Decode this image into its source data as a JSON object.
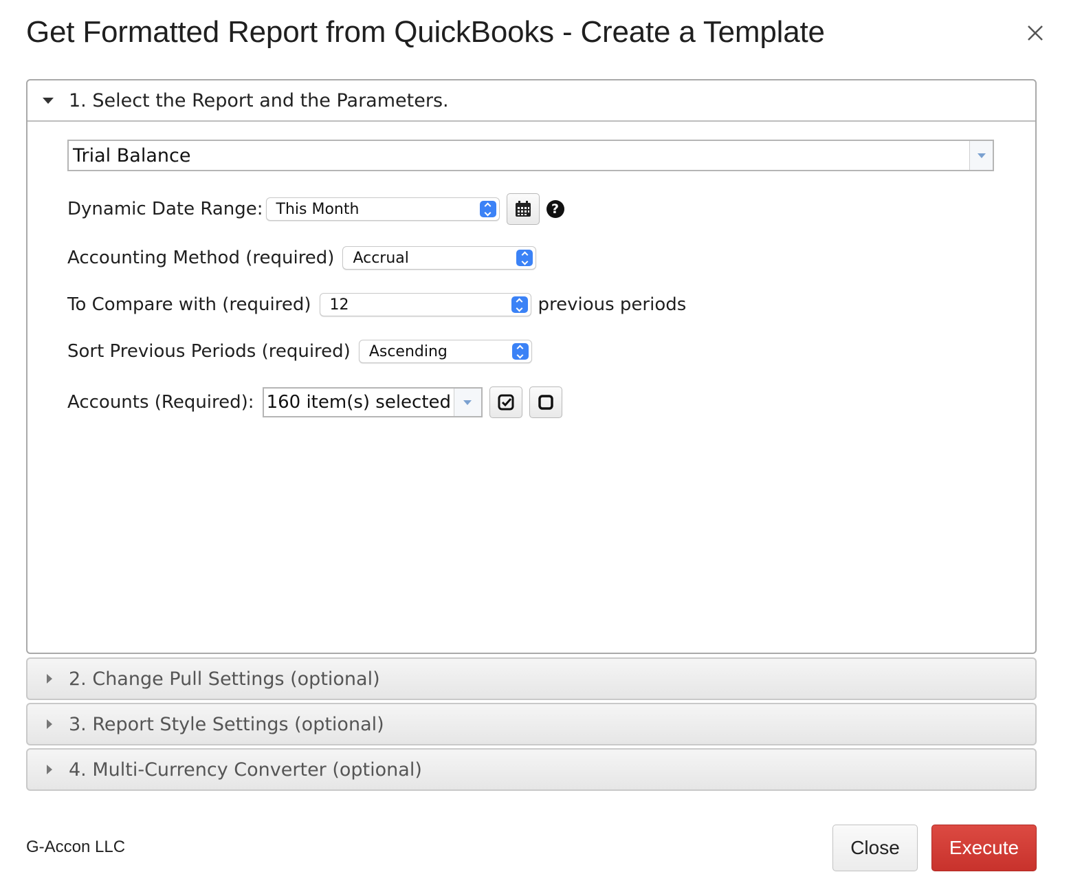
{
  "dialog": {
    "title": "Get Formatted Report from QuickBooks - Create a Template",
    "close_icon": "close-icon"
  },
  "sections": [
    {
      "label": "1. Select the Report and the Parameters.",
      "expanded": true
    },
    {
      "label": "2. Change Pull Settings (optional)",
      "expanded": false
    },
    {
      "label": "3. Report Style Settings (optional)",
      "expanded": false
    },
    {
      "label": "4. Multi-Currency Converter (optional)",
      "expanded": false
    }
  ],
  "report": {
    "selected": "Trial Balance"
  },
  "params": {
    "date_range_label": "Dynamic Date Range:",
    "date_range_value": "This Month",
    "accounting_label": "Accounting Method (required)",
    "accounting_value": "Accrual",
    "compare_label": "To Compare with (required)",
    "compare_value": "12",
    "compare_suffix": "previous periods",
    "sort_label": "Sort Previous Periods (required)",
    "sort_value": "Ascending",
    "accounts_label": "Accounts (Required):",
    "accounts_value": "160 item(s) selected"
  },
  "footer": {
    "brand": "G-Accon LLC",
    "close_label": "Close",
    "execute_label": "Execute"
  },
  "colors": {
    "accent_blue": "#3b82f6",
    "execute_red": "#d03a33"
  }
}
